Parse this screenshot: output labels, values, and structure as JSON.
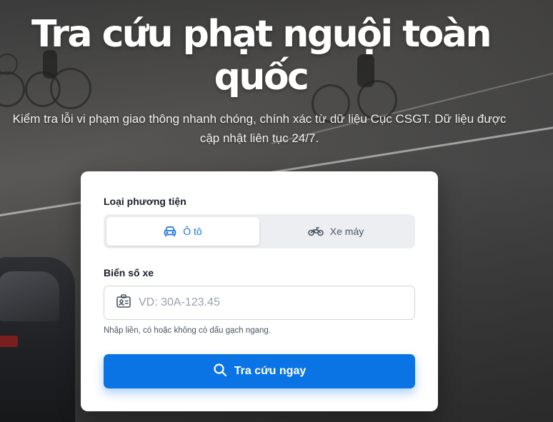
{
  "hero": {
    "title": "Tra cứu phạt nguội toàn quốc",
    "subtitle": "Kiểm tra lỗi vi phạm giao thông nhanh chóng, chính xác từ dữ liệu Cục CSGT. Dữ liệu được cập nhật liên tục 24/7."
  },
  "form": {
    "vehicle_type_label": "Loại phương tiện",
    "vehicle_types": [
      {
        "label": "Ô tô",
        "icon": "car-icon",
        "selected": true
      },
      {
        "label": "Xe máy",
        "icon": "motorbike-icon",
        "selected": false
      }
    ],
    "plate_label": "Biển số xe",
    "plate_value": "",
    "plate_placeholder": "VD: 30A-123.45",
    "plate_icon": "id-card-icon",
    "hint": "Nhập liền, có hoặc không có dấu gạch ngang.",
    "submit_label": "Tra cứu ngay",
    "submit_icon": "search-icon"
  },
  "colors": {
    "accent": "#0b74e5",
    "active_tab_text": "#1a73e8",
    "card_bg": "#ffffff"
  }
}
